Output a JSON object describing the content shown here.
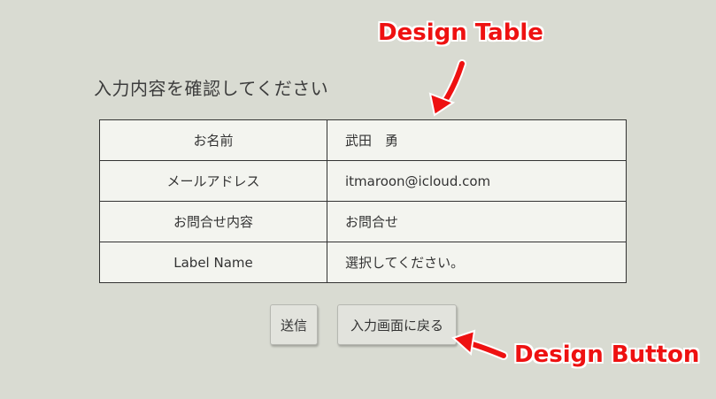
{
  "page": {
    "heading": "入力内容を確認してください"
  },
  "table": {
    "rows": [
      {
        "label": "お名前",
        "value": "武田　勇"
      },
      {
        "label": "メールアドレス",
        "value": "itmaroon@icloud.com"
      },
      {
        "label": "お問合せ内容",
        "value": "お問合せ"
      },
      {
        "label": "Label Name",
        "value": "選択してください。"
      }
    ]
  },
  "buttons": {
    "submit_label": "送信",
    "back_label": "入力画面に戻る"
  },
  "annotations": {
    "table_label": "Design Table",
    "button_label": "Design Button",
    "color": "#ee1111"
  }
}
